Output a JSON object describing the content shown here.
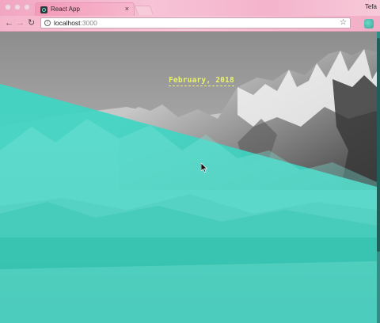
{
  "browser": {
    "tab_title": "React App",
    "tab_close_glyph": "×",
    "profile_name": "Tefa",
    "url_host": "localhost",
    "url_port": ":3000",
    "back_glyph": "←",
    "forward_glyph": "→",
    "reload_glyph": "↻",
    "star_glyph": "☆",
    "info_glyph": "i"
  },
  "page": {
    "date_label": "February, 2018",
    "overlay_color": "#3fd6c4"
  }
}
